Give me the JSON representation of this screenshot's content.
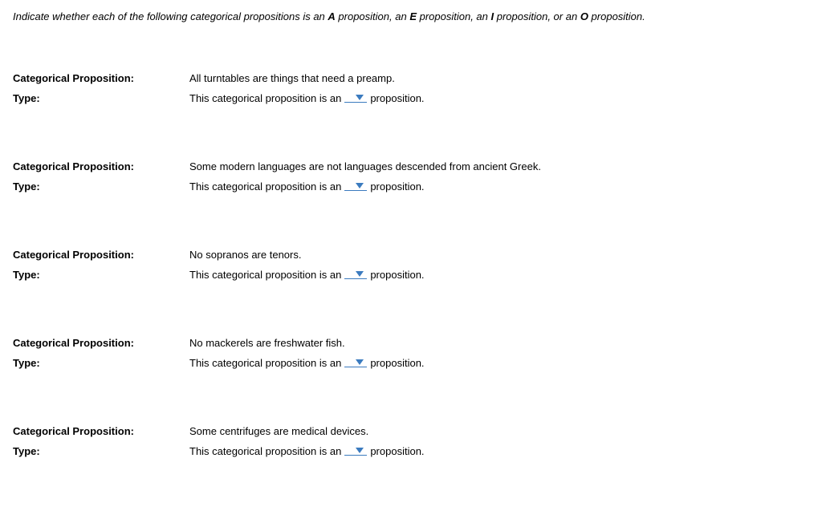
{
  "instructions": {
    "prefix": "Indicate whether each of the following categorical propositions is an ",
    "a": "A",
    "mid1": " proposition, an ",
    "e": "E",
    "mid2": " proposition, an ",
    "i": "I",
    "mid3": " proposition, or an ",
    "o": "O",
    "suffix": " proposition."
  },
  "labels": {
    "proposition": "Categorical Proposition:",
    "type": "Type:"
  },
  "answer": {
    "prefix": "This categorical proposition is an",
    "suffix": "proposition."
  },
  "questions": [
    {
      "text": "All turntables are things that need a preamp."
    },
    {
      "text": "Some modern languages are not languages descended from ancient Greek."
    },
    {
      "text": "No sopranos are tenors."
    },
    {
      "text": "No mackerels are freshwater fish."
    },
    {
      "text": "Some centrifuges are medical devices."
    }
  ]
}
